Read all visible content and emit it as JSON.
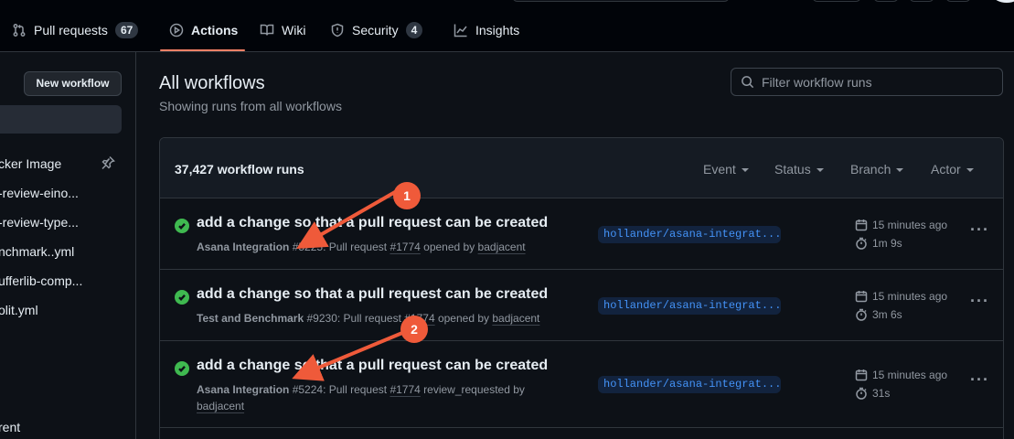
{
  "nav": {
    "tabs": [
      {
        "label": "Pull requests",
        "count": "67",
        "icon": "pull-request-icon"
      },
      {
        "label": "Actions",
        "icon": "play-icon"
      },
      {
        "label": "Wiki",
        "icon": "book-icon"
      },
      {
        "label": "Security",
        "count": "4",
        "icon": "shield-icon"
      },
      {
        "label": "Insights",
        "icon": "graph-icon"
      }
    ],
    "active_tab": "Actions"
  },
  "sidebar": {
    "new_workflow_label": "New workflow",
    "items": [
      "cker Image",
      "-review-eino...",
      "-review-type...",
      "nchmark..yml",
      "ufferlib-comp...",
      "olit.yml",
      "rent"
    ]
  },
  "main": {
    "title": "All workflows",
    "subtitle": "Showing runs from all workflows",
    "filter_placeholder": "Filter workflow runs"
  },
  "runs": {
    "count_label": "37,427 workflow runs",
    "filters": [
      "Event",
      "Status",
      "Branch",
      "Actor"
    ],
    "items": [
      {
        "title": "add a change so that a pull request can be created",
        "workflow": "Asana Integration",
        "run_number": "#5225",
        "meta_mid": ": Pull request ",
        "pr": "#1774",
        "action": " opened by ",
        "user": "badjacent",
        "branch": "hollander/asana-integrat...",
        "time": "15 minutes ago",
        "duration": "1m 9s",
        "status": "success"
      },
      {
        "title": "add a change so that a pull request can be created",
        "workflow": "Test and Benchmark",
        "run_number": "#9230",
        "meta_mid": ": Pull request ",
        "pr": "#1774",
        "action": " opened by ",
        "user": "badjacent",
        "branch": "hollander/asana-integrat...",
        "time": "15 minutes ago",
        "duration": "3m 6s",
        "status": "success"
      },
      {
        "title": "add a change so that a pull request can be created",
        "workflow": "Asana Integration",
        "run_number": "#5224",
        "meta_mid": ": Pull request ",
        "pr": "#1774",
        "action": " review_requested by",
        "user": "badjacent",
        "branch": "hollander/asana-integrat...",
        "time": "15 minutes ago",
        "duration": "31s",
        "status": "success"
      }
    ]
  },
  "annotations": [
    {
      "number": "1",
      "color": "#ef5a3a"
    },
    {
      "number": "2",
      "color": "#ef5a3a"
    }
  ]
}
